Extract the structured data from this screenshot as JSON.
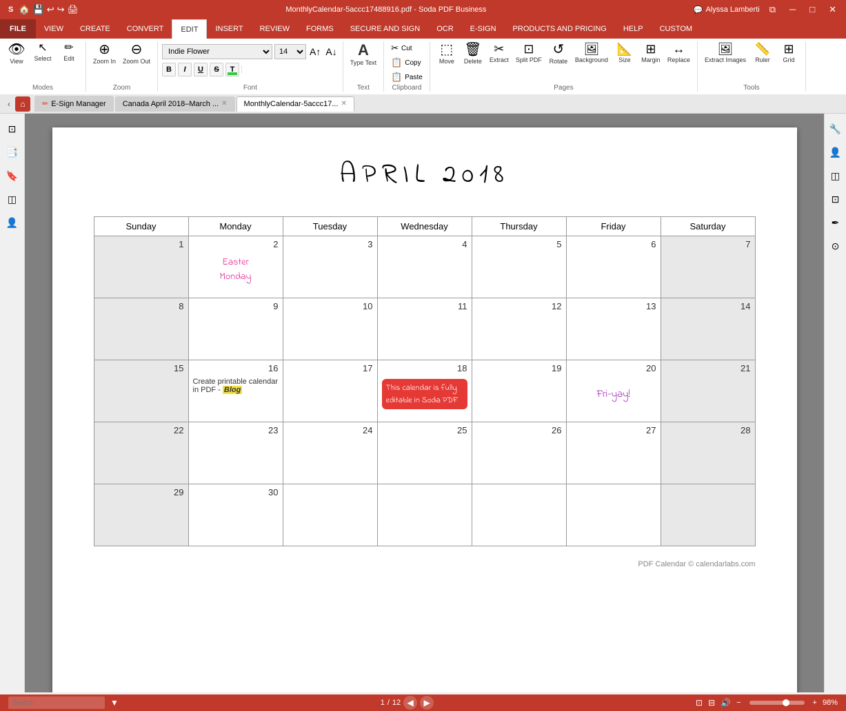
{
  "titlebar": {
    "title": "MonthlyCalendar-5accc17488916.pdf  -  Soda PDF Business",
    "user": "Alyssa Lamberti",
    "controls": [
      "restore",
      "minimize",
      "maximize",
      "close"
    ]
  },
  "ribbon": {
    "tabs": [
      {
        "label": "FILE",
        "id": "file",
        "type": "file"
      },
      {
        "label": "VIEW",
        "id": "view"
      },
      {
        "label": "CREATE",
        "id": "create"
      },
      {
        "label": "CONVERT",
        "id": "convert"
      },
      {
        "label": "EDIT",
        "id": "edit",
        "active": true
      },
      {
        "label": "INSERT",
        "id": "insert"
      },
      {
        "label": "REVIEW",
        "id": "review"
      },
      {
        "label": "FORMS",
        "id": "forms"
      },
      {
        "label": "SECURE AND SIGN",
        "id": "secure"
      },
      {
        "label": "OCR",
        "id": "ocr"
      },
      {
        "label": "E-SIGN",
        "id": "esign"
      },
      {
        "label": "PRODUCTS AND PRICING",
        "id": "products"
      },
      {
        "label": "HELP",
        "id": "help"
      },
      {
        "label": "CUSTOM",
        "id": "custom"
      }
    ],
    "modes_group": {
      "label": "Modes",
      "buttons": [
        {
          "icon": "👁",
          "label": "View"
        },
        {
          "icon": "↖",
          "label": "Select"
        },
        {
          "icon": "✏",
          "label": "Edit"
        }
      ]
    },
    "zoom_group": {
      "label": "Zoom",
      "buttons": [
        {
          "icon": "🔍+",
          "label": "Zoom In"
        },
        {
          "icon": "🔍-",
          "label": "Zoom Out"
        }
      ]
    },
    "font_group": {
      "label": "Font",
      "font_name": "Indie Flower",
      "font_size": "14",
      "bold": false,
      "italic": false,
      "underline": false,
      "strikethrough": false,
      "color": "#2ecc40"
    },
    "text_group": {
      "label": "Text",
      "buttons": [
        {
          "icon": "A",
          "label": "Type Text"
        },
        {
          "icon": "📋",
          "label": "Copy"
        },
        {
          "icon": "📋",
          "label": "Paste"
        }
      ]
    },
    "clipboard_group": {
      "label": "Clipboard",
      "buttons": [
        {
          "icon": "✂",
          "label": "Cut"
        },
        {
          "icon": "📋",
          "label": "Copy"
        },
        {
          "icon": "📋",
          "label": "Paste"
        }
      ]
    },
    "pages_group": {
      "label": "Pages",
      "buttons": [
        {
          "icon": "⬚",
          "label": "Move"
        },
        {
          "icon": "🗑",
          "label": "Delete"
        },
        {
          "icon": "✂",
          "label": "Extract"
        },
        {
          "icon": "⊡",
          "label": "Split PDF"
        },
        {
          "icon": "↺",
          "label": "Rotate"
        },
        {
          "icon": "🖼",
          "label": "Background"
        },
        {
          "icon": "📐",
          "label": "Size"
        },
        {
          "icon": "⊞",
          "label": "Margin"
        },
        {
          "icon": "↔",
          "label": "Replace"
        }
      ]
    },
    "tools_group": {
      "label": "Tools",
      "buttons": [
        {
          "icon": "⊡",
          "label": "Extract Images"
        },
        {
          "icon": "📏",
          "label": "Ruler"
        },
        {
          "icon": "⊞",
          "label": "Grid"
        }
      ]
    }
  },
  "doc_tabs": {
    "nav_back": "‹",
    "nav_fwd": "›",
    "home_icon": "⌂",
    "tabs": [
      {
        "label": "E-Sign Manager",
        "closeable": false,
        "active": false,
        "icon": "✏"
      },
      {
        "label": "Canada April 2018–March ...",
        "closeable": true,
        "active": false,
        "icon": ""
      },
      {
        "label": "MonthlyCalendar-5accc17...",
        "closeable": true,
        "active": true,
        "icon": ""
      }
    ]
  },
  "sidebar_left": {
    "buttons": [
      {
        "icon": "⊡",
        "name": "thumbnail-view"
      },
      {
        "icon": "📑",
        "name": "pages-panel"
      },
      {
        "icon": "🔖",
        "name": "bookmarks-panel"
      },
      {
        "icon": "◫",
        "name": "layers-panel"
      },
      {
        "icon": "👤",
        "name": "signatures-panel"
      }
    ]
  },
  "sidebar_right": {
    "buttons": [
      {
        "icon": "🔧",
        "name": "properties"
      },
      {
        "icon": "👤",
        "name": "comments"
      },
      {
        "icon": "◫",
        "name": "attachments"
      },
      {
        "icon": "⊡",
        "name": "thumbnails"
      },
      {
        "icon": "✒",
        "name": "sign"
      },
      {
        "icon": "⊙",
        "name": "target"
      }
    ]
  },
  "calendar": {
    "title": "APRIL  2018",
    "days": [
      "Sunday",
      "Monday",
      "Tuesday",
      "Wednesday",
      "Thursday",
      "Friday",
      "Saturday"
    ],
    "weeks": [
      [
        {
          "num": "1",
          "gray": true
        },
        {
          "num": "2",
          "note": "Easter Monday",
          "noteColor": "pink"
        },
        {
          "num": "3"
        },
        {
          "num": "4"
        },
        {
          "num": "5"
        },
        {
          "num": "6"
        },
        {
          "num": "7",
          "gray": true
        }
      ],
      [
        {
          "num": "8",
          "gray": true
        },
        {
          "num": "9"
        },
        {
          "num": "10"
        },
        {
          "num": "11"
        },
        {
          "num": "12"
        },
        {
          "num": "13"
        },
        {
          "num": "14",
          "gray": true
        }
      ],
      [
        {
          "num": "15",
          "gray": true
        },
        {
          "num": "16",
          "content": "create_printable"
        },
        {
          "num": "17"
        },
        {
          "num": "18",
          "content": "calendar_note"
        },
        {
          "num": "19"
        },
        {
          "num": "20",
          "content": "fri_yay"
        },
        {
          "num": "21",
          "gray": true
        }
      ],
      [
        {
          "num": "22",
          "gray": true
        },
        {
          "num": "23"
        },
        {
          "num": "24"
        },
        {
          "num": "25"
        },
        {
          "num": "26"
        },
        {
          "num": "27"
        },
        {
          "num": "28",
          "gray": true
        }
      ],
      [
        {
          "num": "29",
          "gray": true
        },
        {
          "num": "30"
        },
        {
          "num": "",
          "empty": true
        },
        {
          "num": "",
          "empty": true
        },
        {
          "num": "",
          "empty": true
        },
        {
          "num": "",
          "empty": true
        },
        {
          "num": "",
          "empty": true,
          "gray": true
        }
      ]
    ],
    "create_printable_text": "Create printable calendar in PDF - Blog",
    "calendar_note_text": "This calendar is fully editable in Soda PDF",
    "fri_yay_text": "Fri-yay!",
    "footer": "PDF Calendar © calendarlabs.com"
  },
  "status_bar": {
    "search_placeholder": "Search",
    "page_current": "1",
    "page_total": "12",
    "zoom_percent": "98%"
  }
}
